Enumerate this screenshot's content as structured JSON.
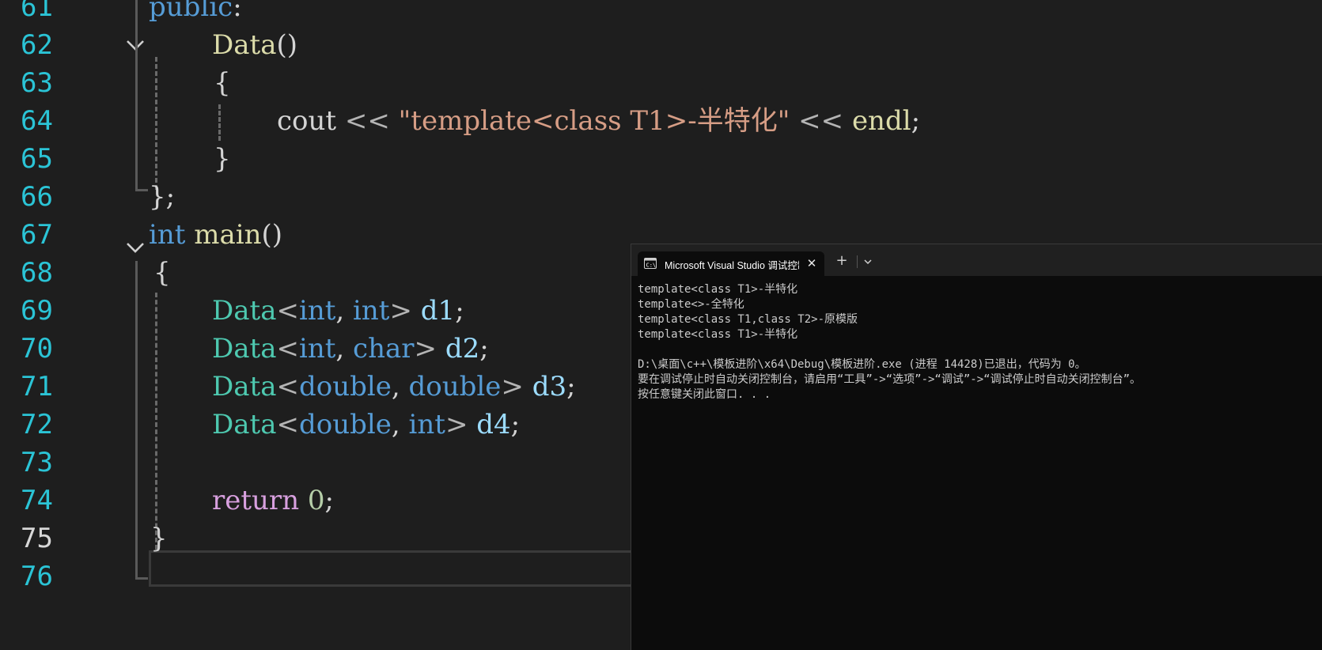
{
  "editor": {
    "line_numbers": [
      "61",
      "62",
      "63",
      "64",
      "65",
      "66",
      "67",
      "68",
      "69",
      "70",
      "71",
      "72",
      "73",
      "74",
      "75",
      "76"
    ],
    "lines": {
      "l61": {
        "kw": "public",
        "colon": ":"
      },
      "l62": {
        "fn": "Data",
        "paren": "()"
      },
      "l63": {
        "brace": "{"
      },
      "l64": {
        "id": "cout",
        "op1": " << ",
        "str": "\"template<class T1>-半特化\"",
        "op2": " << ",
        "fn": "endl",
        "semi": ";"
      },
      "l65": {
        "brace": "}"
      },
      "l66": {
        "brace": "};"
      },
      "l67": {
        "kw": "int",
        "fn": "main",
        "paren": "()"
      },
      "l68": {
        "brace": "{"
      },
      "l69": {
        "ty": "Data",
        "lt": "<",
        "a": "int",
        "comma": ", ",
        "b": "int",
        "gt": ">",
        "var": "d1",
        "semi": ";"
      },
      "l70": {
        "ty": "Data",
        "lt": "<",
        "a": "int",
        "comma": ", ",
        "b": "char",
        "gt": ">",
        "var": "d2",
        "semi": ";"
      },
      "l71": {
        "ty": "Data",
        "lt": "<",
        "a": "double",
        "comma": ", ",
        "b": "double",
        "gt": ">",
        "var": "d3",
        "semi": ";"
      },
      "l72": {
        "ty": "Data",
        "lt": "<",
        "a": "double",
        "comma": ", ",
        "b": "int",
        "gt": ">",
        "var": "d4",
        "semi": ";"
      },
      "l74": {
        "kw": "return",
        "num": "0",
        "semi": ";"
      },
      "l75": {
        "brace": "}"
      }
    }
  },
  "console": {
    "tab_title": "Microsoft Visual Studio 调试控制台",
    "close_glyph": "✕",
    "new_tab_glyph": "+",
    "output": [
      "template<class T1>-半特化",
      "template<>-全特化",
      "template<class T1,class T2>-原模版",
      "template<class T1>-半特化",
      "",
      "D:\\桌面\\c++\\模板进阶\\x64\\Debug\\模板进阶.exe (进程 14428)已退出，代码为 0。",
      "要在调试停止时自动关闭控制台，请启用“工具”->“选项”->“调试”->“调试停止时自动关闭控制台”。",
      "按任意键关闭此窗口. . ."
    ]
  },
  "colors": {
    "editor_bg": "#1e1e1e",
    "line_number": "#2bc4d6",
    "keyword": "#569cd6",
    "control_keyword": "#d8a0df",
    "type": "#4ec9b0",
    "function": "#dcdcaa",
    "string": "#d69d85",
    "variable": "#9cdcfe",
    "number": "#b5cea8",
    "console_bg": "#0c0c0c",
    "console_text": "#cccccc"
  }
}
